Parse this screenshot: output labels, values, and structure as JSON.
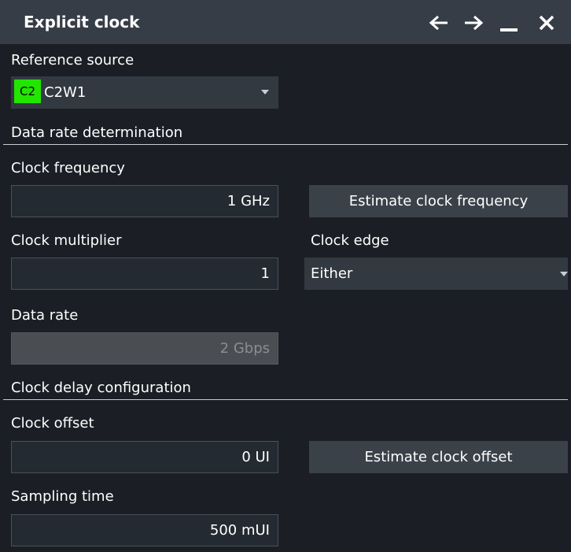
{
  "window": {
    "title": "Explicit clock"
  },
  "reference_source": {
    "label": "Reference source",
    "badge": "C2",
    "badge_color": "#22e600",
    "value": "C2W1"
  },
  "data_rate_section": {
    "heading": "Data rate determination"
  },
  "clock_frequency": {
    "label": "Clock frequency",
    "value": "1 GHz",
    "button": "Estimate clock frequency"
  },
  "clock_multiplier": {
    "label": "Clock multiplier",
    "value": "1"
  },
  "clock_edge": {
    "label": "Clock edge",
    "value": "Either"
  },
  "data_rate": {
    "label": "Data rate",
    "value": "2 Gbps"
  },
  "delay_section": {
    "heading": "Clock delay configuration"
  },
  "clock_offset": {
    "label": "Clock offset",
    "value": "0 UI",
    "button": "Estimate clock offset"
  },
  "sampling_time": {
    "label": "Sampling time",
    "value": "500 mUI"
  }
}
